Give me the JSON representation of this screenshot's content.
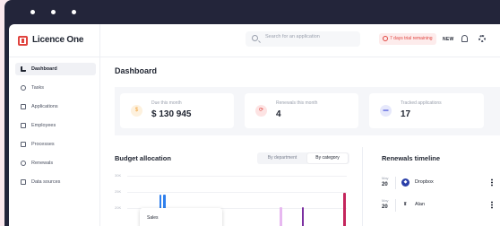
{
  "app": {
    "name": "Licence One"
  },
  "topbar": {
    "search_placeholder": "Search for an application",
    "trial_label": "7 days trial remaining",
    "new_label": "NEW"
  },
  "sidebar": {
    "items": [
      {
        "label": "Dashboard",
        "active": true
      },
      {
        "label": "Tasks"
      },
      {
        "label": "Applications"
      },
      {
        "label": "Employees"
      },
      {
        "label": "Processes"
      },
      {
        "label": "Renewals"
      },
      {
        "label": "Data sources"
      }
    ]
  },
  "main": {
    "title": "Dashboard",
    "stats": [
      {
        "label": "Due this month",
        "value": "$ 130 945",
        "icon": "dollar-icon",
        "symbol": "$",
        "color": "#f3a33c"
      },
      {
        "label": "Renewals this month",
        "value": "4",
        "icon": "renewal-icon",
        "symbol": "⟳",
        "color": "#e0443f"
      },
      {
        "label": "Tracked applications",
        "value": "17",
        "icon": "apps-icon",
        "symbol": "▬",
        "color": "#7f86e6"
      }
    ],
    "budget": {
      "title": "Budget allocation",
      "toggle": [
        "By department",
        "By category"
      ],
      "active_toggle": "By category",
      "tooltip_label": "Sales"
    },
    "renewals": {
      "title": "Renewals timeline",
      "items": [
        {
          "month": "May",
          "day": "20",
          "name": "Dropbox",
          "icon": "dropbox-icon",
          "color": "#2a3fa8"
        },
        {
          "month": "May",
          "day": "20",
          "name": "Alan",
          "icon": "alan-icon",
          "color": "#1f2430"
        }
      ]
    }
  },
  "chart_data": {
    "type": "bar",
    "title": "Budget allocation",
    "y_ticks": [
      "30K",
      "25K",
      "20K"
    ],
    "ylim": [
      15000,
      30000
    ],
    "bars": [
      {
        "x": 0.09,
        "value": 19500,
        "color": "#a8c8f0"
      },
      {
        "x": 0.115,
        "value": 19800,
        "color": "#2f80ed"
      },
      {
        "x": 0.145,
        "value": 24300,
        "color": "#2f80ed"
      },
      {
        "x": 0.165,
        "value": 24300,
        "color": "#2f80ed"
      },
      {
        "x": 0.695,
        "value": 20600,
        "color": "#e7b8f0"
      },
      {
        "x": 0.795,
        "value": 20600,
        "color": "#7b2fa0"
      },
      {
        "x": 0.985,
        "value": 24800,
        "color": "#c4255c"
      }
    ]
  }
}
